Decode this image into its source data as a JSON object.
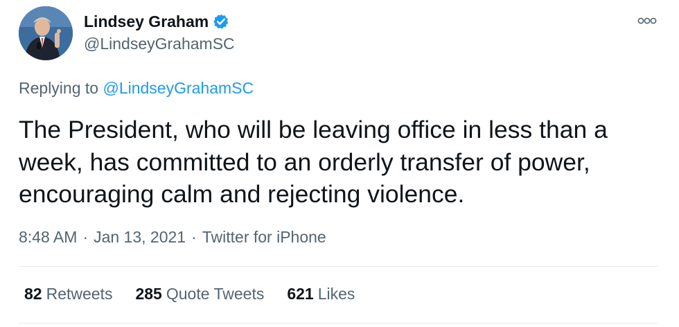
{
  "author": {
    "display_name": "Lindsey Graham",
    "handle": "@LindseyGrahamSC",
    "verified": true,
    "verified_color": "#1d9bf0"
  },
  "reply": {
    "prefix": "Replying to ",
    "target": "@LindseyGrahamSC"
  },
  "tweet": {
    "text": "The President, who will be leaving office in less than a week, has committed to an orderly transfer of power, encouraging calm and rejecting violence."
  },
  "meta": {
    "time": "8:48 AM",
    "separator": "·",
    "date": "Jan 13, 2021",
    "source": "Twitter for iPhone"
  },
  "stats": [
    {
      "count": "82",
      "label": "Retweets"
    },
    {
      "count": "285",
      "label": "Quote Tweets"
    },
    {
      "count": "621",
      "label": "Likes"
    }
  ],
  "icons": {
    "more": "more-options-icon",
    "verified": "verified-badge-icon"
  },
  "colors": {
    "link": "#1d9bf0",
    "secondary_text": "#536471",
    "primary_text": "#0f1419"
  }
}
